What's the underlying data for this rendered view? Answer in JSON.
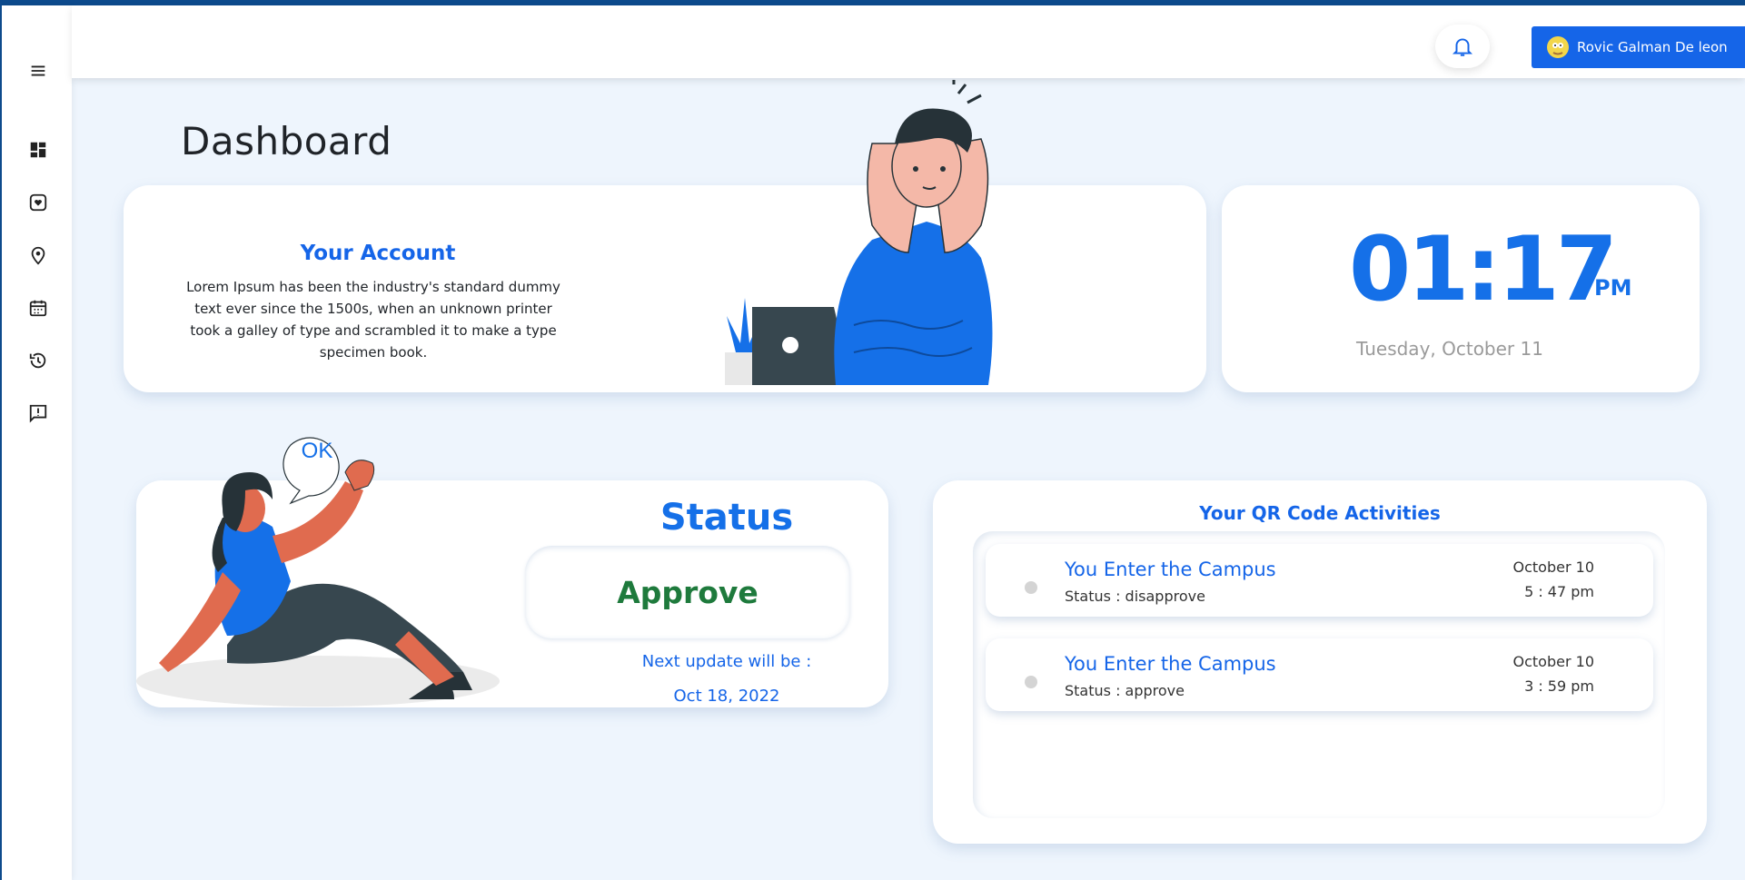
{
  "topbar": {
    "user_name": "Rovic Galman De leon"
  },
  "sidebar": {
    "items": [
      {
        "icon": "menu-icon"
      },
      {
        "icon": "dashboard-icon"
      },
      {
        "icon": "health-icon"
      },
      {
        "icon": "location-icon"
      },
      {
        "icon": "calendar-icon"
      },
      {
        "icon": "history-icon"
      },
      {
        "icon": "feedback-icon"
      }
    ]
  },
  "page": {
    "title": "Dashboard"
  },
  "account": {
    "title": "Your Account",
    "text": "Lorem Ipsum has been the industry's standard dummy text ever since the 1500s, when an unknown printer took a galley of type and scrambled it to make a type specimen book."
  },
  "clock": {
    "time": "01:17",
    "ampm": "PM",
    "date": "Tuesday, October 11"
  },
  "status": {
    "title": "Status",
    "value": "Approve",
    "next_label": "Next update will be :",
    "next_date": "Oct 18, 2022",
    "bubble": "OK"
  },
  "qr": {
    "title": "Your QR Code Activities",
    "items": [
      {
        "head": "You Enter the Campus",
        "status": "Status : disapprove",
        "date": "October 10",
        "time": "5 : 47 pm"
      },
      {
        "head": "You Enter the Campus",
        "status": "Status : approve",
        "date": "October 10",
        "time": "3 : 59 pm"
      }
    ]
  },
  "colors": {
    "accent": "#1565e8",
    "approve": "#1e7a3c",
    "background": "#eef5fd"
  }
}
